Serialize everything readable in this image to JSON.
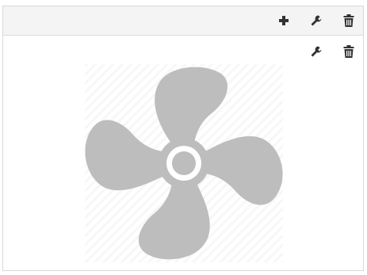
{
  "toolbar": {
    "icons": [
      "plus-icon",
      "wrench-icon",
      "trash-icon"
    ]
  },
  "item": {
    "icons": [
      "wrench-icon",
      "trash-icon"
    ],
    "image": {
      "subject": "fan-icon",
      "color": "#bdbdbd"
    }
  },
  "colors": {
    "icon": "#333333",
    "header_bg": "#f4f4f4",
    "border": "#d9d9d9"
  }
}
